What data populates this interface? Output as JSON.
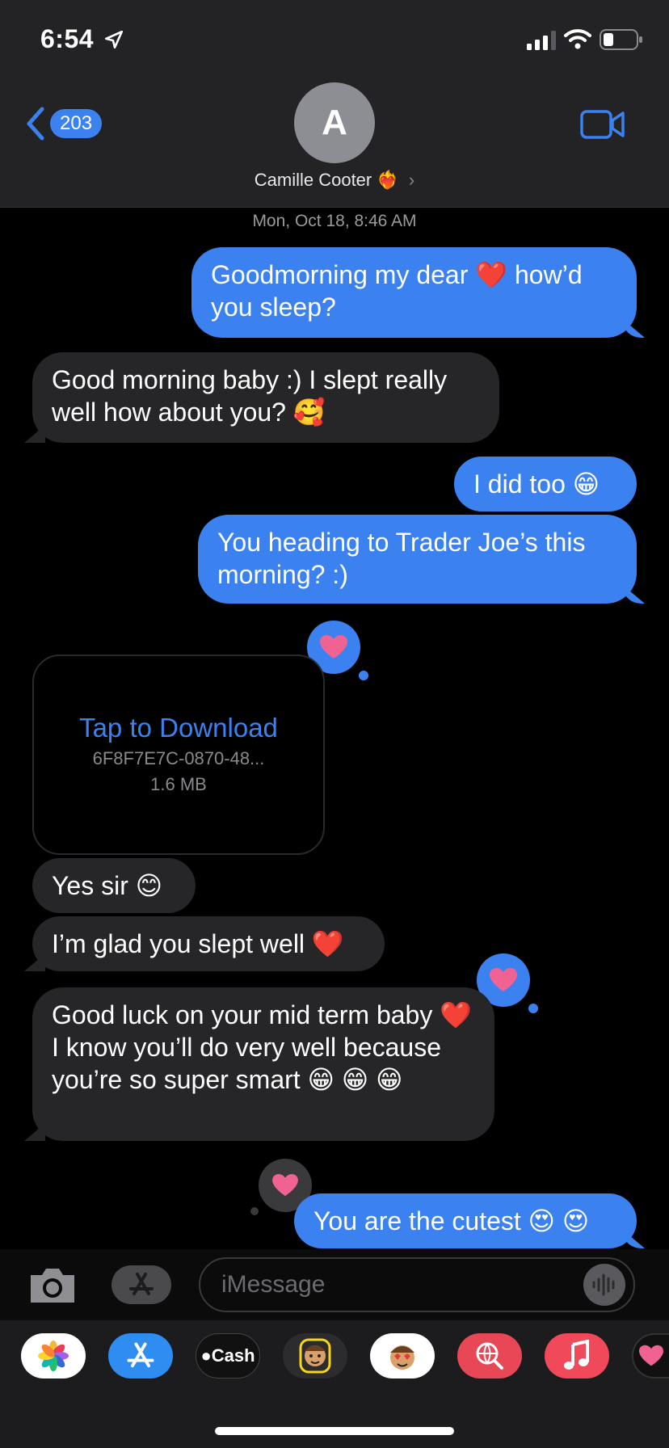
{
  "status_bar": {
    "time": "6:54"
  },
  "header": {
    "back_count": "203",
    "avatar_initial": "A",
    "contact_name": "Camille Cooter",
    "contact_emoji": "❤️‍🔥",
    "chevron": "›"
  },
  "conversation": {
    "timestamp": "Mon, Oct 18, 8:46 AM",
    "messages": [
      {
        "direction": "outgoing",
        "text": "Goodmorning my dear ❤️ how’d you sleep?"
      },
      {
        "direction": "incoming",
        "text": "Good morning baby :) I slept really well how about you? 🥰"
      },
      {
        "direction": "outgoing",
        "text": "I did too 😁"
      },
      {
        "direction": "outgoing",
        "text": "You heading to Trader Joe’s this morning? :)"
      },
      {
        "direction": "incoming",
        "type": "attachment",
        "title": "Tap to Download",
        "filename": "6F8F7E7C-0870-48...",
        "size": "1.6 MB",
        "reaction": "heart"
      },
      {
        "direction": "incoming",
        "text": "Yes sir 😊"
      },
      {
        "direction": "incoming",
        "text": "I’m glad you slept well ❤️"
      },
      {
        "direction": "incoming",
        "text": "Good luck on your mid term baby ❤️ I know you’ll do very well because you’re so super smart 😁 😁 😁",
        "reaction": "heart"
      },
      {
        "direction": "outgoing",
        "text": "You are the cutest 😍 😍",
        "reaction": "heart"
      }
    ]
  },
  "compose": {
    "placeholder": "iMessage"
  },
  "app_drawer": {
    "apps": [
      "Photos",
      "App Store",
      "Cash",
      "Memoji",
      "Memoji Stickers",
      "Web Search",
      "Music",
      "Digital Touch"
    ],
    "cash_label": "Cash"
  },
  "colors": {
    "accent": "#3b82f0",
    "incoming_bubble": "#262628",
    "header_bg": "#232325",
    "heart": "#f06292"
  }
}
